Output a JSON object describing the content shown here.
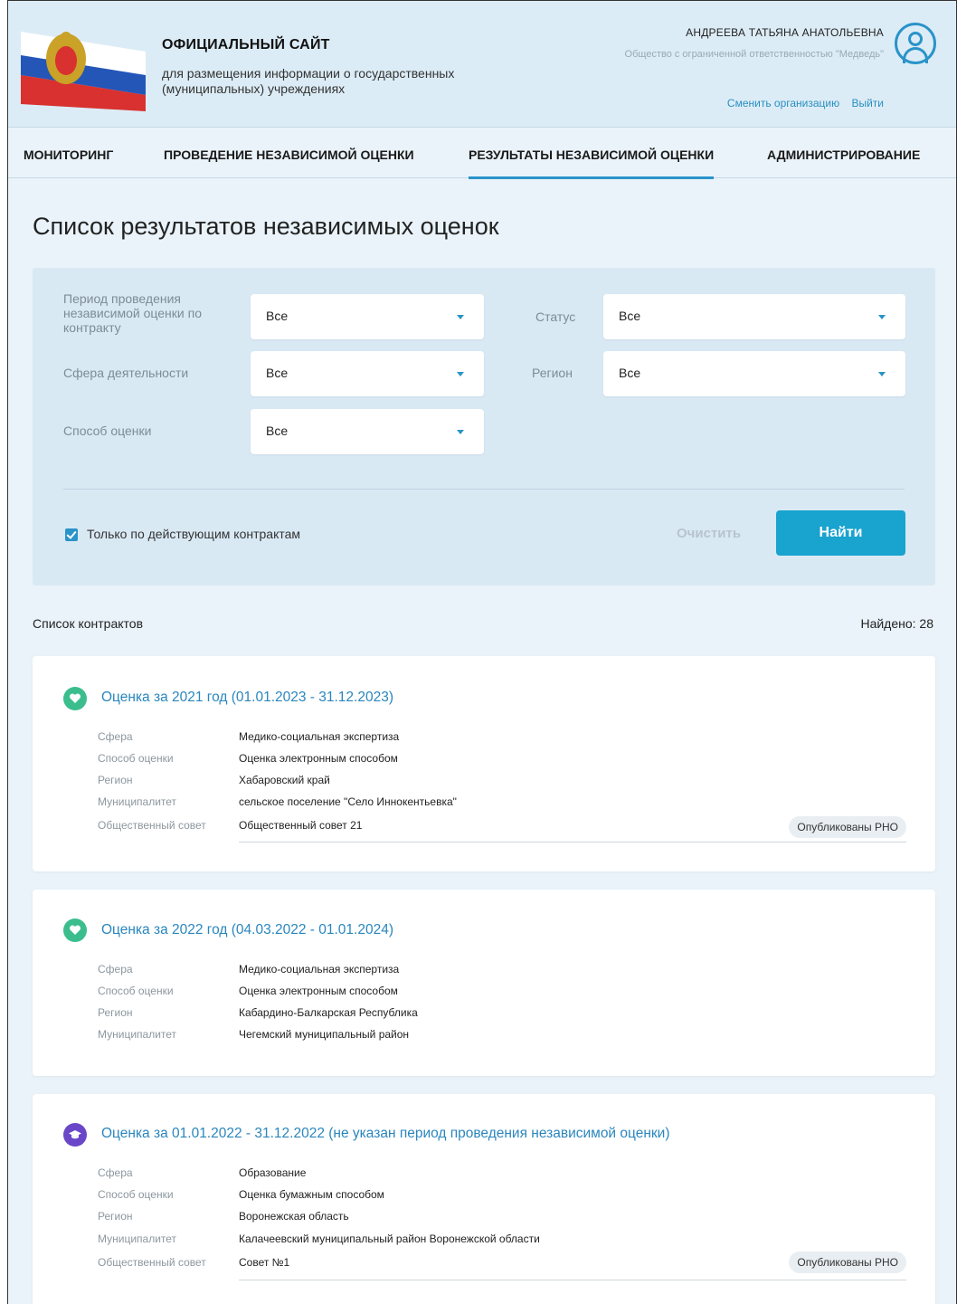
{
  "header": {
    "site_title": "ОФИЦИАЛЬНЫЙ САЙТ",
    "site_subtitle": "для размещения информации о государственных (муниципальных) учреждениях",
    "user_name": "АНДРЕЕВА ТАТЬЯНА АНАТОЛЬЕВНА",
    "user_org": "Общество с ограниченной ответственностью \"Медведь\"",
    "change_org_label": "Сменить организацию",
    "logout_label": "Выйти",
    "flag_colors": [
      "#ffffff",
      "#2456b8",
      "#d8312f"
    ]
  },
  "nav": {
    "items": [
      {
        "label": "МОНИТОРИНГ"
      },
      {
        "label": "ПРОВЕДЕНИЕ НЕЗАВИСИМОЙ ОЦЕНКИ"
      },
      {
        "label": "РЕЗУЛЬТАТЫ НЕЗАВИСИМОЙ ОЦЕНКИ"
      },
      {
        "label": "АДМИНИСТРИРОВАНИЕ"
      }
    ],
    "active": "РЕЗУЛЬТАТЫ НЕЗАВИСИМОЙ ОЦЕНКИ"
  },
  "page_title": "Список результатов независимых оценок",
  "filters": {
    "period_label": "Период проведения независимой оценки по контракту",
    "period_value": "Все",
    "status_label": "Статус",
    "status_value": "Все",
    "sphere_label": "Сфера деятельности",
    "sphere_value": "Все",
    "region_label": "Регион",
    "region_value": "Все",
    "method_label": "Способ оценки",
    "method_value": "Все",
    "active_only_label": "Только по действующим контрактам",
    "active_only_checked": true,
    "clear_label": "Очистить",
    "find_label": "Найти"
  },
  "list": {
    "title": "Список контрактов",
    "found": "Найдено: 28"
  },
  "labels": {
    "sphere": "Сфера",
    "method": "Способ оценки",
    "region": "Регион",
    "municipality": "Муниципалитет",
    "council": "Общественный совет"
  },
  "cards": [
    {
      "title": "Оценка за 2021 год (01.01.2023 - 31.12.2023)",
      "icon": "heart-icon",
      "icon_color": "#3bbd8d",
      "sphere": "Медико-социальная экспертиза",
      "method": "Оценка электронным способом",
      "region": "Хабаровский край",
      "municipality": "сельское поселение \"Село Иннокентьевка\"",
      "council": "Общественный совет 21",
      "badge": "Опубликованы РНО"
    },
    {
      "title": "Оценка за 2022 год (04.03.2022 - 01.01.2024)",
      "icon": "heart-icon",
      "icon_color": "#3bbd8d",
      "sphere": "Медико-социальная экспертиза",
      "method": "Оценка электронным способом",
      "region": "Кабардино-Балкарская Республика",
      "municipality": "Чегемский муниципальный район"
    },
    {
      "title": "Оценка за 01.01.2022 - 31.12.2022 (не указан период проведения независимой оценки)",
      "icon": "graduation-cap-icon",
      "icon_color": "#6a47c8",
      "sphere": "Образование",
      "method": "Оценка бумажным способом",
      "region": "Воронежская область",
      "municipality": "Калачеевский муниципальный район Воронежской области",
      "council": "Совет №1",
      "badge": "Опубликованы РНО"
    }
  ],
  "accent_color": "#2a93c9",
  "button_color": "#19a3cf"
}
